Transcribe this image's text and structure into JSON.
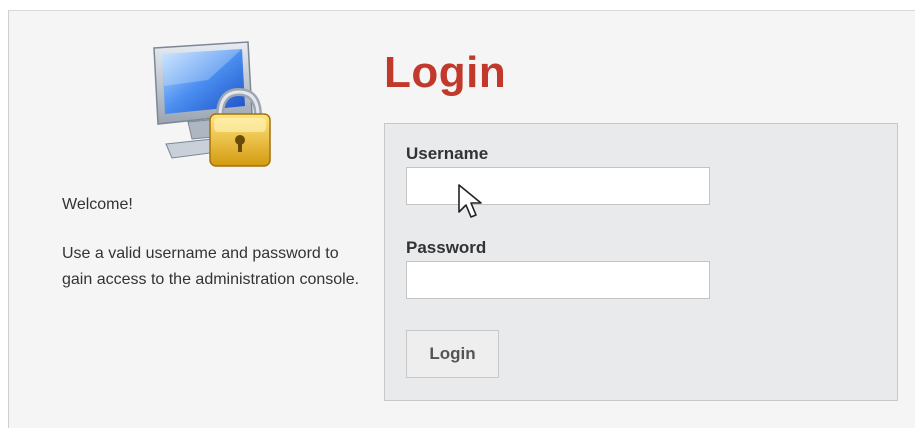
{
  "welcome_text": "Welcome!",
  "description": "Use a valid username and password to gain access to the administration console.",
  "title": "Login",
  "form": {
    "username_label": "Username",
    "username_value": "",
    "password_label": "Password",
    "password_value": "",
    "submit_label": "Login"
  },
  "icons": {
    "logo": "monitor-lock-icon",
    "cursor": "mouse-pointer-icon"
  },
  "colors": {
    "title": "#c0392b",
    "form_background": "#e8eaec"
  }
}
